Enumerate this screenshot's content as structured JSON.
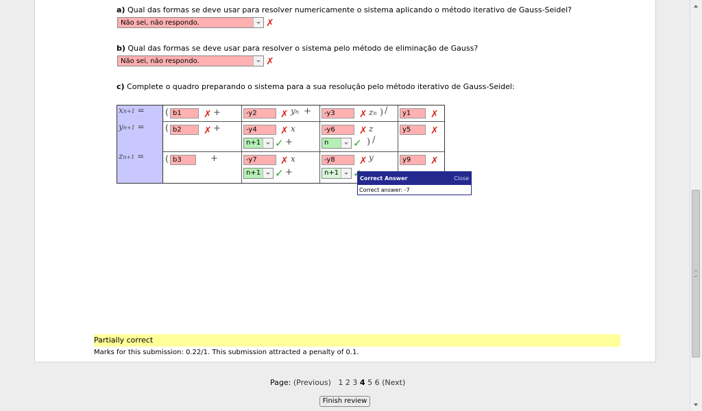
{
  "questions": {
    "a": {
      "letter": "a)",
      "text": " Qual das formas se deve usar para resolver numericamente o sistema aplicando o método iterativo de Gauss-Seidel?",
      "answer": "Não sei, não respondo."
    },
    "b": {
      "letter": "b)",
      "text": " Qual das formas se deve usar para resolver o sistema pelo método de eliminação de Gauss?",
      "answer": "Não sei, não respondo."
    },
    "c": {
      "letter": "c)",
      "text": " Complete o quadro preparando o sistema para a sua resolução pelo método iterativo de Gauss-Seidel:"
    }
  },
  "table": {
    "lhs": {
      "x": {
        "var": "x",
        "sub": "n+1",
        "eq": "="
      },
      "y": {
        "var": "y",
        "sub": "n+1",
        "eq": "="
      },
      "z": {
        "var": "z",
        "sub": "n+1",
        "eq": "="
      }
    },
    "paren": "(",
    "paren_close": ")",
    "slash": "/",
    "plus": "+",
    "row1": {
      "b": "b1",
      "c2": "-y2",
      "c2var": "y",
      "c2sub": "n",
      "c3": "-y3",
      "c3var": "z",
      "c3sub": "n",
      "c4": "y1"
    },
    "row2": {
      "b": "b2",
      "c2": "-y4",
      "c2var": "x",
      "c2sel": "n+1",
      "c3": "-y6",
      "c3var": "z",
      "c3sel": "n",
      "c4": "y5"
    },
    "row3": {
      "b": "b3",
      "c2": "-y7",
      "c2var": "x",
      "c2sel": "n+1",
      "c3": "-y8",
      "c3var": "y",
      "c3sel": "n+1",
      "c4": "y9"
    }
  },
  "tooltip": {
    "title": "Correct Answer",
    "close": "Close",
    "body": "Correct answer: -7"
  },
  "feedback": {
    "status": "Partially correct",
    "marks": "Marks for this submission: 0.22/1. This submission attracted a penalty of 0.1."
  },
  "pager": {
    "label": "Page:",
    "prev": "(Previous)",
    "pages": [
      "1",
      "2",
      "3",
      "4",
      "5",
      "6"
    ],
    "current": "4",
    "next": "(Next)"
  },
  "finish_label": "Finish review",
  "colors": {
    "wrong_bg": "#ffb0b0",
    "right_bg": "#b6f0b6",
    "lhs_bg": "#c8c8ff",
    "feedback_bg": "#ffff99",
    "tooltip_header": "#25298e"
  }
}
